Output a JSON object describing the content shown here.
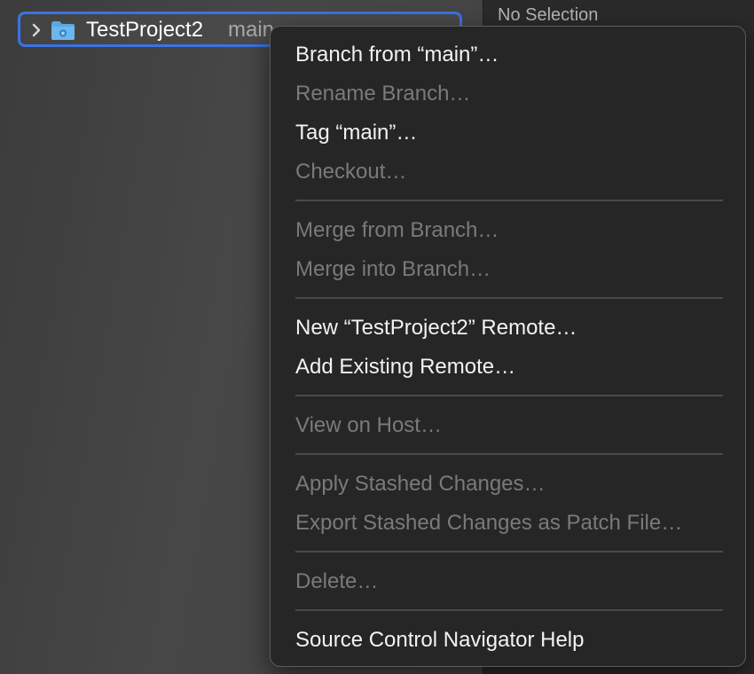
{
  "navigator": {
    "project_name": "TestProject2",
    "branch": "main",
    "icons": {
      "disclosure": "chevron-right-icon",
      "folder": "folder-icon"
    }
  },
  "inspector": {
    "title": "No Selection"
  },
  "context_menu": {
    "items": [
      {
        "label": "Branch from “main”…",
        "enabled": true
      },
      {
        "label": "Rename Branch…",
        "enabled": false
      },
      {
        "label": "Tag “main”…",
        "enabled": true
      },
      {
        "label": "Checkout…",
        "enabled": false
      },
      {
        "label": "Merge from Branch…",
        "enabled": false
      },
      {
        "label": "Merge into Branch…",
        "enabled": false
      },
      {
        "label": "New “TestProject2” Remote…",
        "enabled": true
      },
      {
        "label": "Add Existing Remote…",
        "enabled": true
      },
      {
        "label": "View on Host…",
        "enabled": false
      },
      {
        "label": "Apply Stashed Changes…",
        "enabled": false
      },
      {
        "label": "Export Stashed Changes as Patch File…",
        "enabled": false
      },
      {
        "label": "Delete…",
        "enabled": false
      },
      {
        "label": "Source Control Navigator Help",
        "enabled": true
      }
    ]
  },
  "colors": {
    "selection_outline": "#3a73e6",
    "folder_blue": "#5aa9e6",
    "menu_background": "#262626",
    "enabled_text": "#f2f2f2",
    "disabled_text": "#7a7a7a"
  }
}
